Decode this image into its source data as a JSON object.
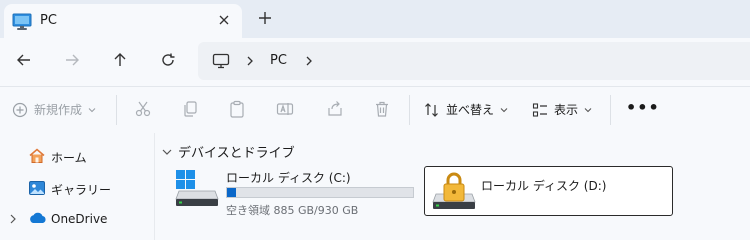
{
  "colors": {
    "accent": "#0a67c9",
    "lock": "#f2b83a",
    "windows_blue": "#1e90e8"
  },
  "tab": {
    "title": "PC",
    "icon": "monitor-icon",
    "close_icon": "close-icon",
    "new_tab_icon": "plus-icon"
  },
  "nav": {
    "back_icon": "arrow-left-icon",
    "forward_icon": "arrow-right-icon",
    "up_icon": "arrow-up-icon",
    "refresh_icon": "refresh-icon"
  },
  "address": {
    "icon": "monitor-icon",
    "segments": [
      "PC"
    ]
  },
  "toolbar": {
    "new_label": "新規作成",
    "disabled_actions": [
      "cut-icon",
      "copy-icon",
      "paste-icon",
      "rename-icon",
      "share-icon",
      "delete-icon"
    ],
    "sort_label": "並べ替え",
    "view_label": "表示",
    "more_label": "•••"
  },
  "sidebar": {
    "items": [
      {
        "label": "ホーム",
        "icon": "home-icon"
      },
      {
        "label": "ギャラリー",
        "icon": "gallery-icon"
      },
      {
        "label": "OneDrive",
        "icon": "onedrive-cloud-icon",
        "expandable": true
      }
    ]
  },
  "main": {
    "group_title": "デバイスとドライブ",
    "drives": [
      {
        "name": "ローカル ディスク (C:)",
        "free_text": "空き領域 885 GB/930 GB",
        "used_fraction": 0.05,
        "icon": "windows-drive-icon"
      },
      {
        "name": "ローカル ディスク (D:)",
        "icon": "locked-drive-icon",
        "selected": true
      }
    ]
  }
}
